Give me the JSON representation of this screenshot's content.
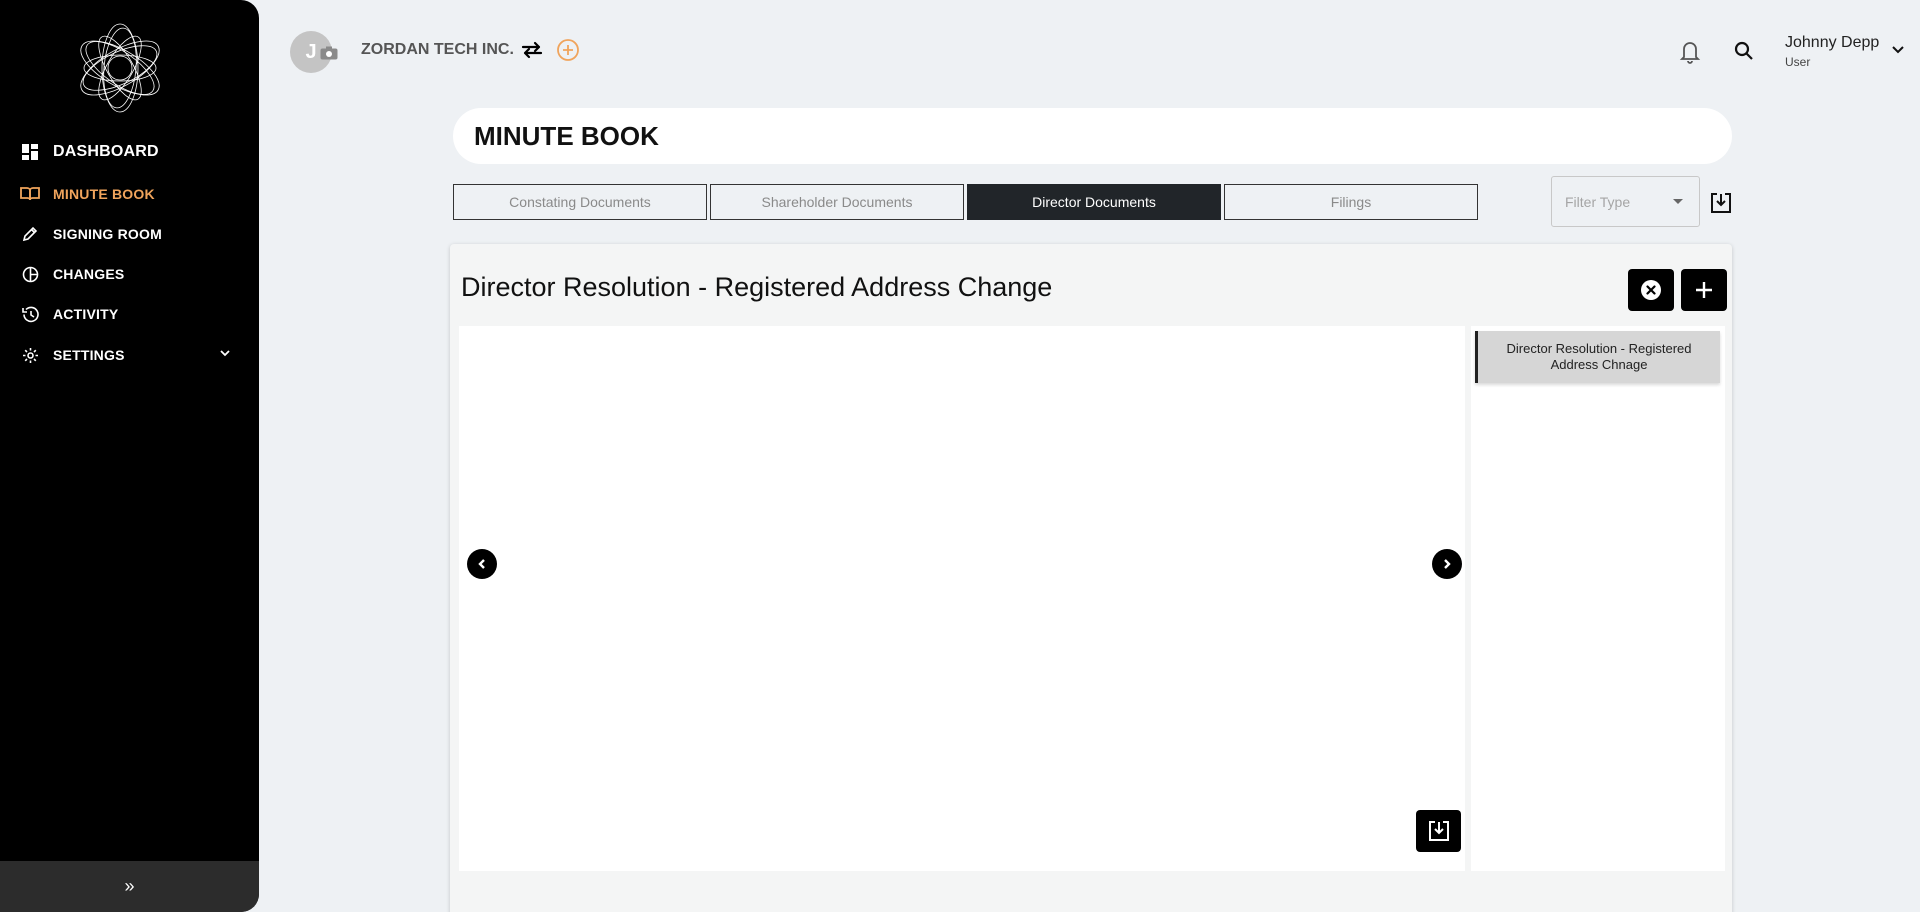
{
  "sidebar": {
    "items": [
      {
        "label": "DASHBOARD",
        "icon": "dashboard-icon"
      },
      {
        "label": "MINUTE BOOK",
        "icon": "book-icon",
        "active": true
      },
      {
        "label": "SIGNING ROOM",
        "icon": "pen-icon"
      },
      {
        "label": "CHANGES",
        "icon": "changes-icon"
      },
      {
        "label": "ACTIVITY",
        "icon": "history-icon"
      },
      {
        "label": "SETTINGS",
        "icon": "gear-icon"
      }
    ],
    "collapse_label": "»"
  },
  "header": {
    "avatar_initial": "J",
    "company": "ZORDAN TECH INC.",
    "user_name": "Johnny Depp",
    "user_role": "User"
  },
  "page": {
    "title": "MINUTE BOOK"
  },
  "tabs": [
    {
      "label": "Constating Documents"
    },
    {
      "label": "Shareholder Documents"
    },
    {
      "label": "Director Documents",
      "active": true
    },
    {
      "label": "Filings"
    }
  ],
  "filter": {
    "placeholder": "Filter Type"
  },
  "document": {
    "title": "Director Resolution - Registered Address Change",
    "list": [
      {
        "label": "Director Resolution - Registered Address Chnage"
      }
    ]
  },
  "colors": {
    "accent": "#f0a45c",
    "sidebar_bg": "#000000",
    "active_tab": "#212529",
    "page_bg": "#eef1f4"
  }
}
